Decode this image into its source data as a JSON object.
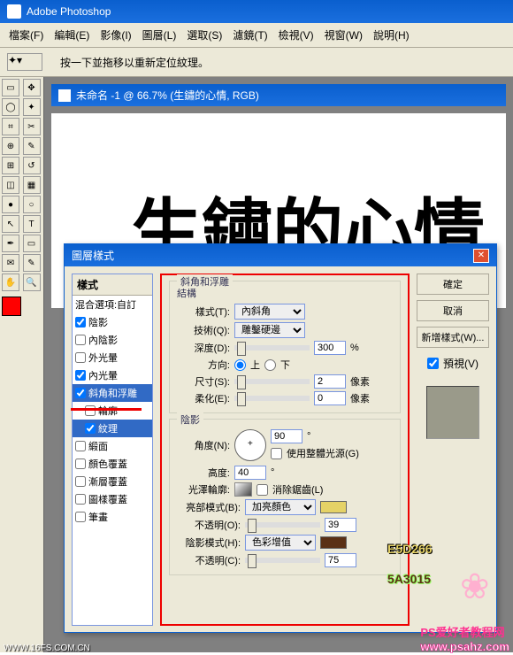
{
  "app": {
    "title": "Adobe Photoshop"
  },
  "menu": [
    "檔案(F)",
    "編輯(E)",
    "影像(I)",
    "圖層(L)",
    "選取(S)",
    "濾鏡(T)",
    "檢視(V)",
    "視窗(W)",
    "說明(H)"
  ],
  "optbar_hint": "按一下並拖移以重新定位紋理。",
  "doc_title": "未命名 -1 @ 66.7% (生鏽的心情, RGB)",
  "canvas_text": "生鏽的心情",
  "dialog": {
    "title": "圖層樣式",
    "styles_header": "樣式",
    "blend_header": "混合選項:自訂",
    "items": [
      {
        "label": "陰影",
        "checked": true
      },
      {
        "label": "內陰影",
        "checked": false
      },
      {
        "label": "外光暈",
        "checked": false
      },
      {
        "label": "內光暈",
        "checked": true
      },
      {
        "label": "斜角和浮雕",
        "checked": true,
        "selected": true
      },
      {
        "label": "輪廓",
        "checked": false,
        "indent": true
      },
      {
        "label": "紋理",
        "checked": true,
        "indent": true
      },
      {
        "label": "緞面",
        "checked": false
      },
      {
        "label": "顏色覆蓋",
        "checked": false
      },
      {
        "label": "漸層覆蓋",
        "checked": false
      },
      {
        "label": "圖樣覆蓋",
        "checked": false
      },
      {
        "label": "筆畫",
        "checked": false
      }
    ],
    "section1_title": "斜角和浮雕",
    "structure_title": "結構",
    "style_label": "樣式(T):",
    "style_value": "內斜角",
    "technique_label": "技術(Q):",
    "technique_value": "雕鑿硬邊",
    "depth_label": "深度(D):",
    "depth_value": "300",
    "depth_unit": "%",
    "direction_label": "方向:",
    "dir_up": "上",
    "dir_down": "下",
    "size_label": "尺寸(S):",
    "size_value": "2",
    "size_unit": "像素",
    "soften_label": "柔化(E):",
    "soften_value": "0",
    "soften_unit": "像素",
    "shading_title": "陰影",
    "angle_label": "角度(N):",
    "angle_value": "90",
    "global_light": "使用整體光源(G)",
    "altitude_label": "高度:",
    "altitude_value": "40",
    "gloss_label": "光澤輪廓:",
    "antialias": "消除鋸齒(L)",
    "highlight_mode_label": "亮部模式(B):",
    "highlight_mode_value": "加亮顏色",
    "highlight_opacity_label": "不透明(O):",
    "highlight_opacity_value": "39",
    "shadow_mode_label": "陰影模式(H):",
    "shadow_mode_value": "色彩增值",
    "shadow_opacity_label": "不透明(C):",
    "shadow_opacity_value": "75",
    "highlight_color": "#E5D266",
    "shadow_color": "#5A3015",
    "btn_ok": "確定",
    "btn_cancel": "取消",
    "btn_new": "新增樣式(W)...",
    "preview_label": "預視(V)"
  },
  "color_code_1": "E5D266",
  "color_code_2": "5A3015",
  "watermark1": "PS爱好者教程网",
  "watermark2": "www.psahz.com",
  "watermark3": "WWW.16FS.COM.CN",
  "foreground_color": "#ff0000"
}
